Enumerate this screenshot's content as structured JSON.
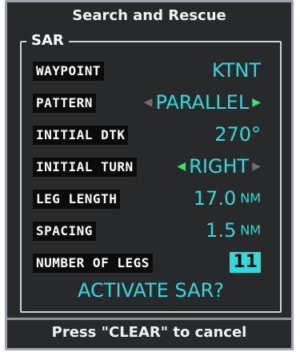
{
  "window": {
    "title": "Search and Rescue"
  },
  "section": {
    "label": "SAR"
  },
  "fields": {
    "waypoint": {
      "label": "WAYPOINT",
      "value": "KTNT"
    },
    "pattern": {
      "label": "PATTERN",
      "value": "PARALLEL",
      "active_arrow": "right"
    },
    "initial_dtk": {
      "label": "INITIAL DTK",
      "value": "270°"
    },
    "initial_turn": {
      "label": "INITIAL TURN",
      "value": "RIGHT",
      "active_arrow": "left"
    },
    "leg_length": {
      "label": "LEG LENGTH",
      "value": "17.0",
      "unit": "NM"
    },
    "spacing": {
      "label": "SPACING",
      "value": "1.5",
      "unit": "NM"
    },
    "number_of_legs": {
      "label": "NUMBER OF LEGS",
      "value": "11",
      "selected": true
    }
  },
  "prompt": {
    "text": "ACTIVATE SAR?"
  },
  "footer": {
    "text": "Press \"CLEAR\" to cancel"
  },
  "colors": {
    "background": "#27292b",
    "value": "#32d9dc",
    "arrow_active": "#34e36a",
    "arrow_inactive": "#6c7071"
  }
}
